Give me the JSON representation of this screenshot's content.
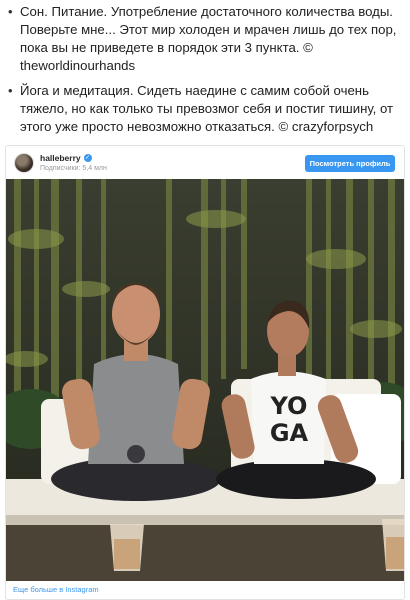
{
  "bullets": [
    "Сон. Питание. Употребление достаточного количества воды. Поверьте мне... Этот мир холоден и мрачен лишь до тех пор, пока вы не приведете в порядок эти 3 пункта. © theworldinourhands",
    "Йога и медитация. Сидеть наедине с самим собой очень тяжело, но как только ты превозмог себя и постиг тишину, от этого уже просто невозможно отказаться. © crazyforpsych"
  ],
  "instagram": {
    "username": "halleberry",
    "followers": "Подписчики: 5,4 млн",
    "view_profile_label": "Посмотреть профиль",
    "shirt_text_line1": "YO",
    "shirt_text_line2": "GA",
    "more_label": "Еще больше в Instagram",
    "accent_color": "#3897f0"
  }
}
